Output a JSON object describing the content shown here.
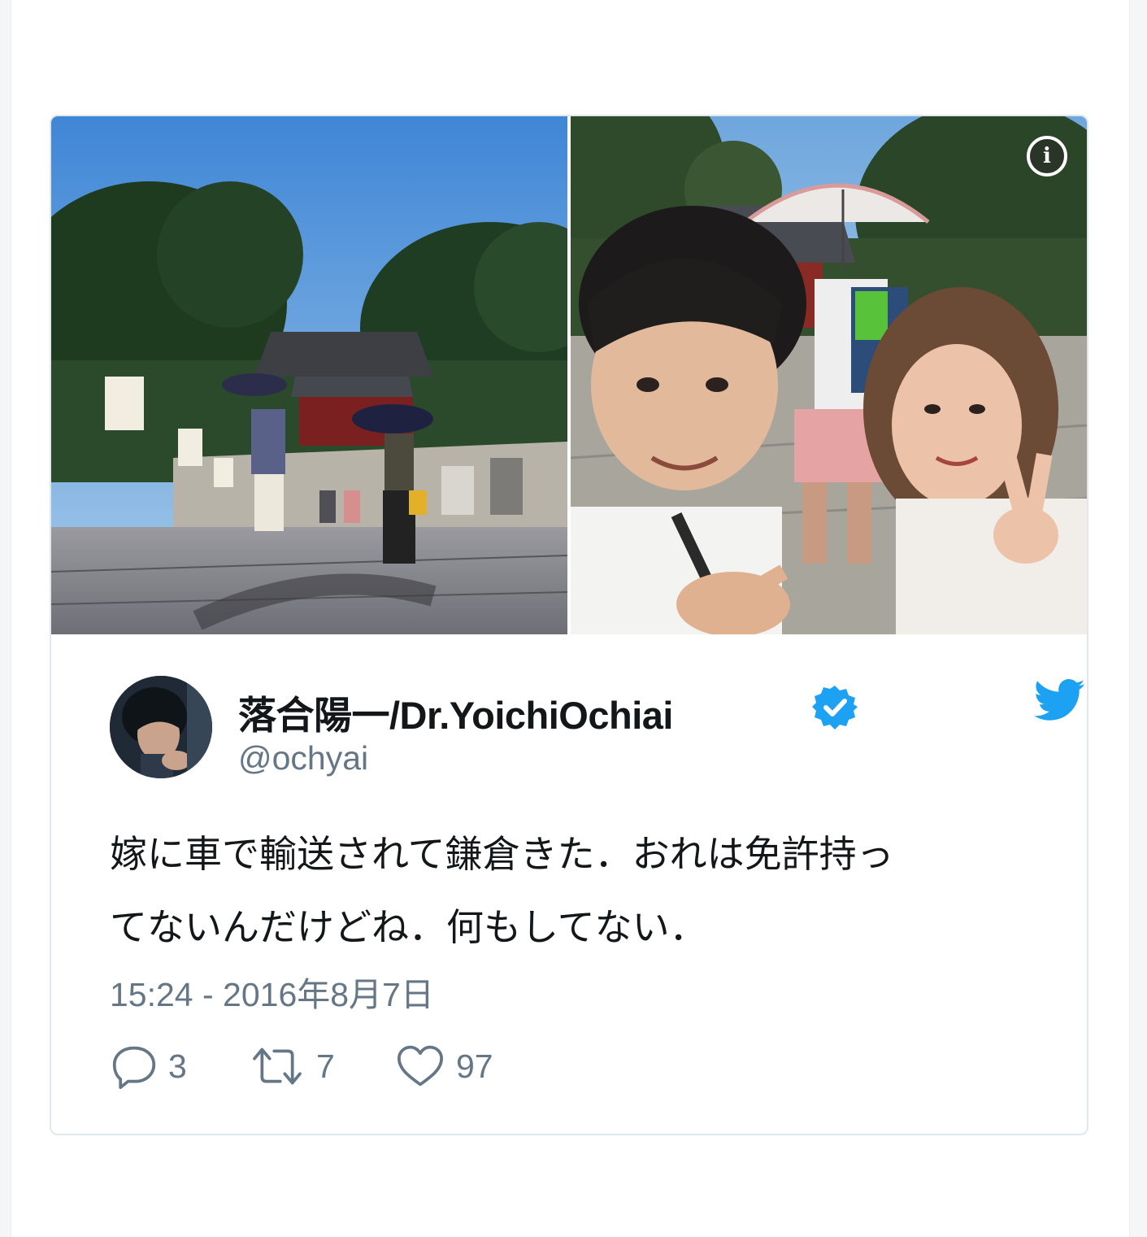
{
  "tweet": {
    "author": {
      "display_name": "落合陽一/Dr.YoichiOchiai",
      "handle": "@ochyai",
      "verified": true
    },
    "text_line_1": "嫁に車で輸送されて鎌倉きた．おれは免許持っ",
    "text_line_2": "てないんだけどね．何もしてない．",
    "timestamp": "15:24 - 2016年8月7日",
    "stats": {
      "replies": "3",
      "retweets": "7",
      "likes": "97"
    },
    "media_info_label": "i",
    "colors": {
      "brand_blue": "#1da1f2",
      "text": "#14171a",
      "secondary_text": "#657786",
      "border": "#e1e8ed"
    }
  }
}
